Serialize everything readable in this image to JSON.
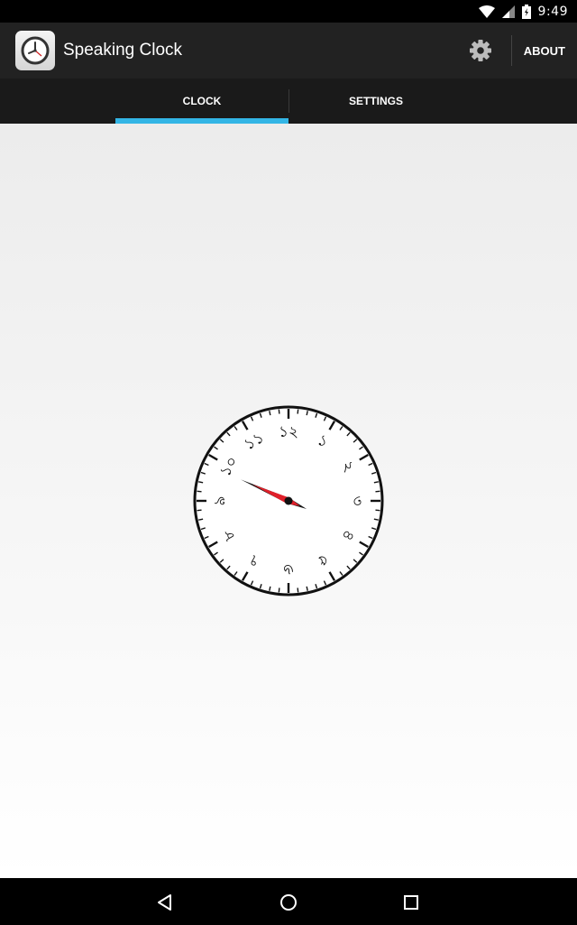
{
  "status_bar": {
    "time": "9:49"
  },
  "app": {
    "title": "Speaking Clock"
  },
  "action_bar": {
    "about_label": "ABOUT"
  },
  "tabs": [
    {
      "label": "CLOCK",
      "selected": true
    },
    {
      "label": "SETTINGS",
      "selected": false
    }
  ],
  "clock": {
    "numerals": [
      "১২",
      "১",
      "২",
      "৩",
      "৪",
      "৫",
      "৬",
      "৭",
      "৮",
      "৯",
      "১০",
      "১১"
    ],
    "hour": 9,
    "minute": 49
  },
  "icons": {
    "status": [
      "wifi-icon",
      "signal-icon",
      "battery-icon"
    ],
    "action": [
      "app-clock-icon",
      "gear-icon"
    ],
    "nav": [
      "back-icon",
      "home-icon",
      "recents-icon"
    ]
  },
  "colors": {
    "action_bar": "#222222",
    "tab_bar": "#1a1a1a",
    "tab_indicator": "#33b5e5",
    "hand_highlight": "#e0202a"
  }
}
